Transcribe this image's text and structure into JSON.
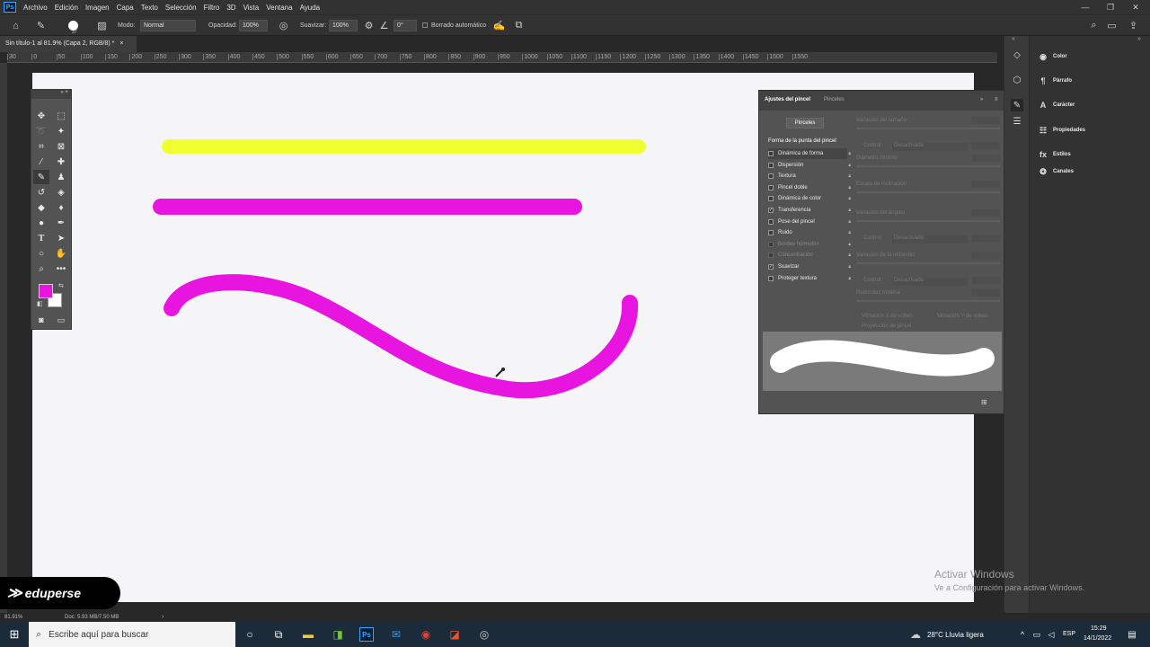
{
  "menubar": {
    "logo": "Ps",
    "items": [
      "Archivo",
      "Edición",
      "Imagen",
      "Capa",
      "Texto",
      "Selección",
      "Filtro",
      "3D",
      "Vista",
      "Ventana",
      "Ayuda"
    ],
    "window_controls": [
      "—",
      "❐",
      "✕"
    ]
  },
  "options": {
    "brush_size": "37",
    "mode_label": "Modo:",
    "mode_value": "Normal",
    "opacity_label": "Opacidad:",
    "opacity_value": "100%",
    "smooth_label": "Suavizar:",
    "smooth_value": "100%",
    "angle_value": "0°",
    "auto_erase_label": "Borrado automático"
  },
  "document": {
    "tab_title": "Sin título-1 al 81.9% (Capa 2, RGB/8) *",
    "close": "×",
    "zoom": "81.91%",
    "doc_info": "Doc: 5.93 MB/7.50 MB",
    "ruler_ticks": [
      "30",
      "0",
      "50",
      "100",
      "150",
      "200",
      "250",
      "300",
      "350",
      "400",
      "450",
      "500",
      "550",
      "600",
      "650",
      "700",
      "750",
      "800",
      "850",
      "900",
      "950",
      "1000",
      "1050",
      "1100",
      "1150",
      "1200",
      "1250",
      "1300",
      "1350",
      "1400",
      "1450",
      "1500",
      "1550"
    ]
  },
  "canvas_strokes": {
    "yellow": "#f0ff30",
    "magenta": "#e814e0"
  },
  "colors": {
    "foreground": "#e814e0",
    "background": "#ffffff"
  },
  "brush_panel": {
    "tab_active": "Ajustes del pincel",
    "tab_inactive": "Pinceles",
    "brushes_button": "Pinceles",
    "tip_shape": "Forma de la punta del pincel",
    "options": [
      {
        "label": "Dinámica de forma",
        "checked": false,
        "enabled": true
      },
      {
        "label": "Dispersión",
        "checked": false,
        "enabled": true
      },
      {
        "label": "Textura",
        "checked": false,
        "enabled": true
      },
      {
        "label": "Pincel doble",
        "checked": false,
        "enabled": true
      },
      {
        "label": "Dinámica de color",
        "checked": false,
        "enabled": true
      },
      {
        "label": "Transferencia",
        "checked": true,
        "enabled": true
      },
      {
        "label": "Pose del pincel",
        "checked": false,
        "enabled": true
      },
      {
        "label": "Ruido",
        "checked": false,
        "enabled": true
      },
      {
        "label": "Bordes húmedos",
        "checked": false,
        "enabled": false
      },
      {
        "label": "Concentración",
        "checked": false,
        "enabled": false
      },
      {
        "label": "Suavizar",
        "checked": true,
        "enabled": true
      },
      {
        "label": "Proteger textura",
        "checked": false,
        "enabled": true
      }
    ],
    "settings": {
      "size_variation": "Variación del tamaño",
      "control1": "Control:",
      "off1": "Desactivado",
      "min_diameter": "Diámetro mínimo",
      "tilt_scale": "Escala de inclinación",
      "angle_variation": "Variación del ángulo",
      "control2": "Control:",
      "off2": "Desactivado",
      "roundness_variation": "Variación de la redondez",
      "control3": "Control:",
      "off3": "Desactivado",
      "min_roundness": "Redondez mínima",
      "flip_x": "Vibración X de volteo",
      "flip_y": "Vibración Y de volteo",
      "projection": "Proyección de pincel"
    }
  },
  "right_panels": [
    "Color",
    "Párrafo",
    "Carácter",
    "Propiedades",
    "Estilos",
    "Canales"
  ],
  "watermark": {
    "line1": "Activar Windows",
    "line2": "Ve a Configuración para activar Windows."
  },
  "overlay_logo": "eduperse",
  "taskbar": {
    "search_placeholder": "Escribe aquí para buscar",
    "weather": "28°C  Lluvia ligera",
    "language": "ESP",
    "time": "15:29",
    "date": "14/1/2022"
  }
}
